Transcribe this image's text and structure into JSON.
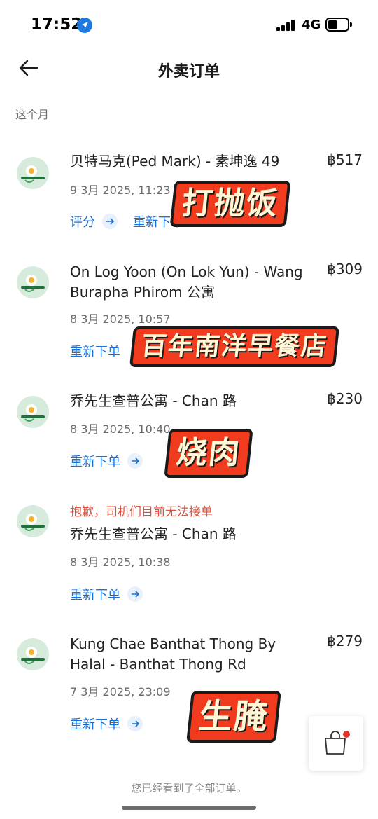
{
  "status": {
    "time": "17:52",
    "network": "4G"
  },
  "header": {
    "title": "外卖订单"
  },
  "section_label": "这个月",
  "orders": [
    {
      "name": "贝特马克(Ped Mark) - 素坤逸 49",
      "price": "฿517",
      "date": "9 3月 2025, 11:23",
      "actions": [
        "评分",
        "重新下单"
      ]
    },
    {
      "name": "On Log Yoon (On Lok Yun) - Wang Burapha Phirom 公寓",
      "price": "฿309",
      "date": "8 3月 2025, 10:57",
      "actions": [
        "重新下单"
      ]
    },
    {
      "name": "乔先生查普公寓 - Chan 路",
      "price": "฿230",
      "date": "8 3月 2025, 10:40",
      "actions": [
        "重新下单"
      ]
    },
    {
      "warning": "抱歉，司机们目前无法接单",
      "name": "乔先生查普公寓 - Chan 路",
      "date": "8 3月 2025, 10:38",
      "actions": [
        "重新下单"
      ]
    },
    {
      "name": "Kung Chae Banthat Thong By Halal - Banthat Thong Rd",
      "price": "฿279",
      "date": "7 3月 2025, 23:09",
      "actions": [
        "重新下单"
      ]
    }
  ],
  "stickers": [
    "打抛饭",
    "百年南洋早餐店",
    "烧肉",
    "生腌"
  ],
  "footer": {
    "end_text": "您已经看到了全部订单。"
  },
  "colors": {
    "accent": "#1a6fd6",
    "warning": "#e0503c",
    "sticker": "#f13b1e"
  }
}
